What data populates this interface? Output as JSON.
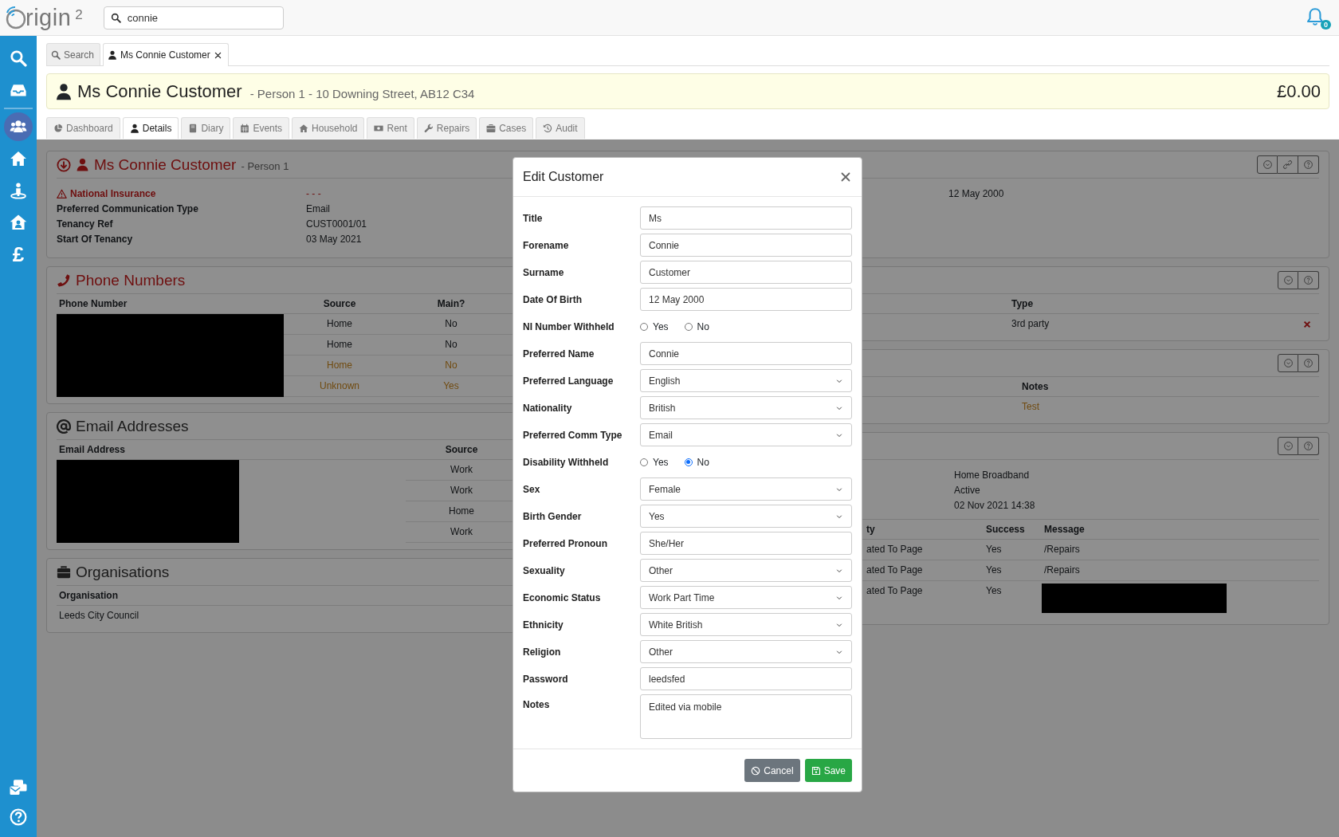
{
  "topbar": {
    "logo": {
      "text": "rigin",
      "superscript": "2"
    },
    "search": {
      "value": "connie"
    },
    "notifications": {
      "count": "0"
    }
  },
  "sidebar": {
    "items": [
      {
        "kind": "icon",
        "selected": false
      },
      {
        "kind": "icon",
        "selected": false
      },
      {
        "kind": "icon",
        "selected": true
      },
      {
        "kind": "icon",
        "selected": false
      },
      {
        "kind": "icon",
        "selected": false
      },
      {
        "kind": "icon",
        "selected": false
      },
      {
        "kind": "glyph",
        "label": "£",
        "selected": false
      }
    ]
  },
  "page_tabs": [
    {
      "label": "Search",
      "selected": false,
      "closable": false
    },
    {
      "label": "Ms Connie Customer",
      "selected": true,
      "closable": true
    }
  ],
  "header": {
    "name": "Ms Connie Customer",
    "details": "- Person 1  - 10 Downing Street, AB12 C34",
    "balance": "£0.00"
  },
  "detail_tabs": [
    {
      "label": "Dashboard",
      "selected": false
    },
    {
      "label": "Details",
      "selected": true
    },
    {
      "label": "Diary",
      "selected": false
    },
    {
      "label": "Events",
      "selected": false
    },
    {
      "label": "Household",
      "selected": false
    },
    {
      "label": "Rent",
      "selected": false
    },
    {
      "label": "Repairs",
      "selected": false
    },
    {
      "label": "Cases",
      "selected": false
    },
    {
      "label": "Audit",
      "selected": false
    }
  ],
  "customer_panel": {
    "title": "Ms Connie Customer",
    "subtitle": "- Person 1",
    "alert": true,
    "fields": [
      {
        "label": "National Insurance",
        "value": "- - -",
        "warning": true
      },
      {
        "label": "Preferred Communication Type",
        "value": "Email",
        "warning": false
      },
      {
        "label": "Tenancy Ref",
        "value": "CUST0001/01",
        "warning": false
      },
      {
        "label": "Start Of Tenancy",
        "value": "03 May 2021",
        "warning": false
      }
    ],
    "right_fields": [
      {
        "value": "12 May 2000"
      }
    ]
  },
  "phone_numbers": {
    "title": "Phone Numbers",
    "alert": true,
    "columns": [
      "Phone Number",
      "Source",
      "Main?"
    ],
    "numbers_redacted": true,
    "rows": [
      {
        "source": "Home",
        "main": "No",
        "highlighted": false
      },
      {
        "source": "Home",
        "main": "No",
        "highlighted": false
      },
      {
        "source": "Home",
        "main": "No",
        "highlighted": true
      },
      {
        "source": "Unknown",
        "main": "Yes",
        "highlighted": true
      }
    ]
  },
  "email_addresses": {
    "title": "Email Addresses",
    "alert": false,
    "columns": [
      "Email Address",
      "Source"
    ],
    "addresses_redacted": true,
    "rows": [
      {
        "source": "Work"
      },
      {
        "source": "Work"
      },
      {
        "source": "Home"
      },
      {
        "source": "Work"
      }
    ]
  },
  "organisations": {
    "title": "Organisations",
    "alert": false,
    "columns": [
      "Organisation"
    ],
    "rows": [
      "Leeds City Council"
    ]
  },
  "contacts_panel": {
    "columns": [
      "Type"
    ],
    "rows": [
      {
        "type": "3rd party",
        "removable": true
      }
    ]
  },
  "notes_panel": {
    "columns": [
      "Notes"
    ],
    "rows": [
      {
        "notes": "Test",
        "highlighted": true
      }
    ]
  },
  "activity_panel": {
    "fields": [
      "Home Broadband",
      "Active",
      "02 Nov 2021 14:38"
    ],
    "columns": [
      "ty",
      "Success",
      "Message"
    ],
    "rows": [
      {
        "activity": "ated To Page",
        "success": "Yes",
        "message": "/Repairs",
        "message_redacted": false
      },
      {
        "activity": "ated To Page",
        "success": "Yes",
        "message": "/Repairs",
        "message_redacted": false
      },
      {
        "activity": "ated To Page",
        "success": "Yes",
        "message_redacted": true
      }
    ]
  },
  "modal": {
    "title": "Edit Customer",
    "fields": [
      {
        "kind": "text",
        "label": "Title",
        "value": "Ms"
      },
      {
        "kind": "text",
        "label": "Forename",
        "value": "Connie"
      },
      {
        "kind": "text",
        "label": "Surname",
        "value": "Customer"
      },
      {
        "kind": "text",
        "label": "Date Of Birth",
        "value": "12 May 2000"
      },
      {
        "kind": "radio",
        "label": "NI Number Withheld",
        "options": [
          {
            "label": "Yes",
            "selected": false
          },
          {
            "label": "No",
            "selected": false
          }
        ]
      },
      {
        "kind": "text",
        "label": "Preferred Name",
        "value": "Connie"
      },
      {
        "kind": "select",
        "label": "Preferred Language",
        "value": "English"
      },
      {
        "kind": "select",
        "label": "Nationality",
        "value": "British"
      },
      {
        "kind": "select",
        "label": "Preferred Comm Type",
        "value": "Email"
      },
      {
        "kind": "radio",
        "label": "Disability Withheld",
        "options": [
          {
            "label": "Yes",
            "selected": false
          },
          {
            "label": "No",
            "selected": true
          }
        ]
      },
      {
        "kind": "select",
        "label": "Sex",
        "value": "Female"
      },
      {
        "kind": "select",
        "label": "Birth Gender",
        "value": "Yes"
      },
      {
        "kind": "text",
        "label": "Preferred Pronoun",
        "value": "She/Her"
      },
      {
        "kind": "select",
        "label": "Sexuality",
        "value": "Other"
      },
      {
        "kind": "select",
        "label": "Economic Status",
        "value": "Work Part Time"
      },
      {
        "kind": "select",
        "label": "Ethnicity",
        "value": "White British"
      },
      {
        "kind": "select",
        "label": "Religion",
        "value": "Other"
      },
      {
        "kind": "text",
        "label": "Password",
        "value": "leedsfed"
      },
      {
        "kind": "textarea",
        "label": "Notes",
        "value": "Edited via mobile"
      }
    ],
    "buttons": [
      {
        "kind": "secondary",
        "label": "Cancel"
      },
      {
        "kind": "primary",
        "label": "Save"
      }
    ]
  }
}
